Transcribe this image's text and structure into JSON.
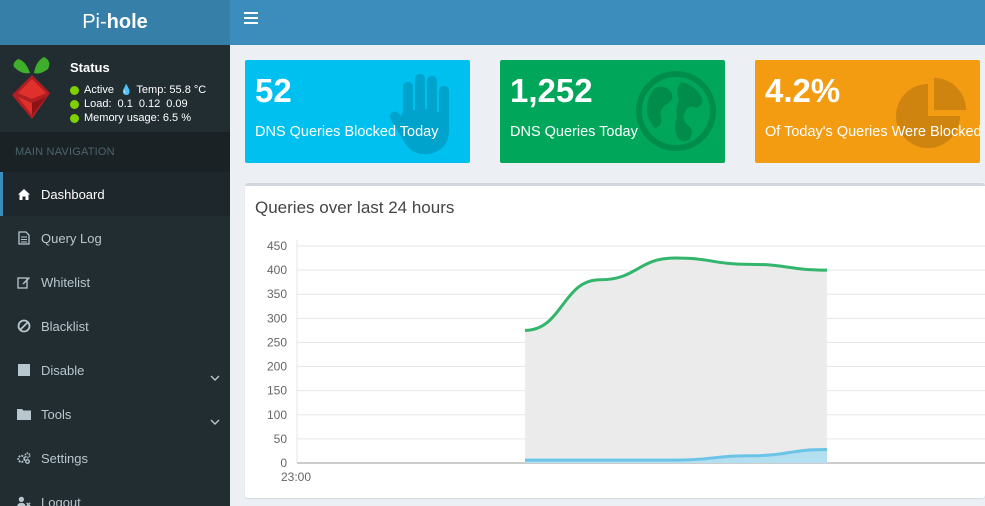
{
  "header": {
    "logo_prefix": "Pi-",
    "logo_bold": "hole"
  },
  "status": {
    "title": "Status",
    "active": "Active",
    "temp": "Temp: 55.8 °C",
    "load_label": "Load:",
    "load_values": [
      "0.1",
      "0.12",
      "0.09"
    ],
    "memory": "Memory usage:  6.5 %"
  },
  "nav": {
    "header": "MAIN NAVIGATION",
    "items": [
      {
        "label": "Dashboard",
        "icon": "home-icon"
      },
      {
        "label": "Query Log",
        "icon": "file-icon"
      },
      {
        "label": "Whitelist",
        "icon": "edit-icon"
      },
      {
        "label": "Blacklist",
        "icon": "ban-icon"
      },
      {
        "label": "Disable",
        "icon": "stop-icon"
      },
      {
        "label": "Tools",
        "icon": "folder-icon"
      },
      {
        "label": "Settings",
        "icon": "gears-icon"
      },
      {
        "label": "Logout",
        "icon": "user-times-icon"
      }
    ]
  },
  "stats": [
    {
      "value": "52",
      "label": "DNS Queries Blocked Today",
      "color": "#00c0ef",
      "icon": "hand-icon"
    },
    {
      "value": "1,252",
      "label": "DNS Queries Today",
      "color": "#00a65a",
      "icon": "globe-icon"
    },
    {
      "value": "4.2%",
      "label": "Of Today's Queries Were Blocked",
      "color": "#f39c12",
      "icon": "pie-chart-icon"
    }
  ],
  "chart": {
    "title": "Queries over last 24 hours"
  },
  "chart_data": {
    "type": "area",
    "title": "Queries over last 24 hours",
    "xlabel": "",
    "ylabel": "",
    "x_tick_labels": [
      "23:00"
    ],
    "y_ticks": [
      0,
      50,
      100,
      150,
      200,
      250,
      300,
      350,
      400,
      450
    ],
    "ylim": [
      0,
      450
    ],
    "grid": true,
    "series": [
      {
        "values": [
          275,
          380,
          425,
          412,
          400
        ],
        "color": "#33b56c",
        "fill": "#ebebeb"
      },
      {
        "values": [
          6,
          6,
          6,
          15,
          28
        ],
        "color": "#6bc4e6",
        "fill": "#b3dff0"
      }
    ]
  }
}
